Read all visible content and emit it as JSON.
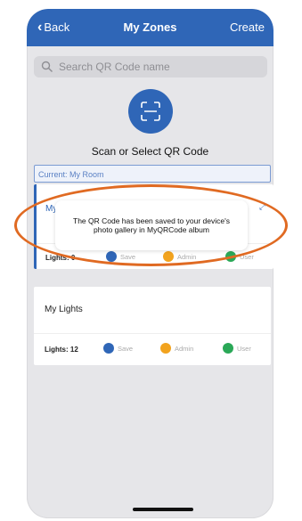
{
  "navbar": {
    "back_label": "Back",
    "title": "My Zones",
    "create_label": "Create"
  },
  "search": {
    "placeholder": "Search QR Code name"
  },
  "scan": {
    "label": "Scan or Select QR Code"
  },
  "current": {
    "label": "Current: My Room"
  },
  "zones": [
    {
      "name": "My Room",
      "lights": "Lights: 0",
      "save": "Save",
      "admin": "Admin",
      "user": "User"
    },
    {
      "name": "My Lights",
      "lights": "Lights: 12",
      "save": "Save",
      "admin": "Admin",
      "user": "User"
    }
  ],
  "toast": {
    "message": "The QR Code has been saved to your device's photo gallery in MyQRCode album"
  },
  "colors": {
    "accent": "#2f66b7",
    "annotation": "#e06a22",
    "admin": "#f2a31e",
    "user": "#2aa857"
  }
}
